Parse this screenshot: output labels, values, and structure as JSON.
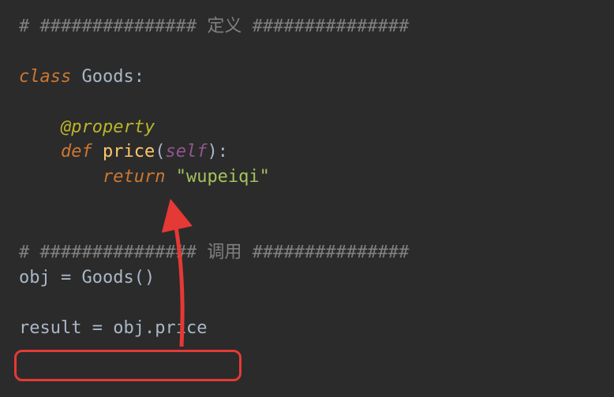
{
  "code": {
    "line1_comment": "# ############### 定义 ###############",
    "line3_class_kw": "class",
    "line3_classname": "Goods",
    "line3_colon": ":",
    "line5_at": "@",
    "line5_dec": "property",
    "line6_def": "def",
    "line6_fn": "price",
    "line6_lp": "(",
    "line6_self": "self",
    "line6_rp": ")",
    "line6_colon": ":",
    "line7_return": "return",
    "line7_str": "\"wupeiqi\"",
    "line10_comment": "# ############### 调用 ###############",
    "line11_obj": "obj",
    "line11_eq": " = ",
    "line11_call": "Goods",
    "line11_lp": "(",
    "line11_rp": ")",
    "line13_result": "result",
    "line13_eq": " = ",
    "line13_obj": "obj",
    "line13_dot": ".",
    "line13_price": "price"
  },
  "annotations": {
    "highlight_target": "result = obj.price",
    "arrow_color": "#e53935"
  }
}
